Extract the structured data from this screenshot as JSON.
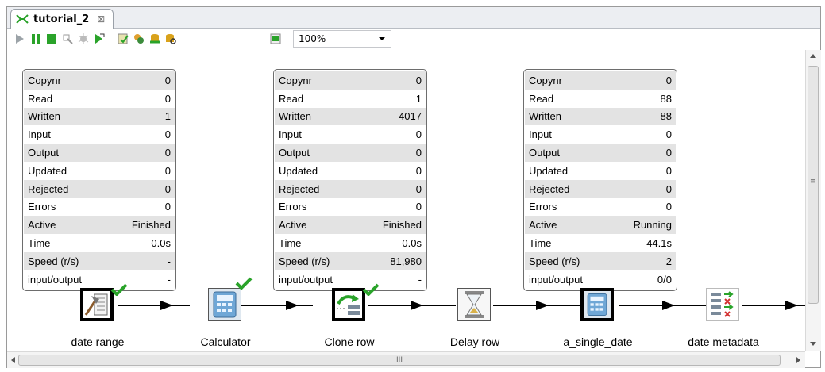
{
  "tab": {
    "title": "tutorial_2",
    "close_symbol": "⊠"
  },
  "toolbar": {
    "buttons": [
      "run-icon",
      "pause-icon",
      "stop-icon",
      "preview-icon",
      "debug-icon",
      "replay-icon",
      "verify-icon",
      "impact-icon",
      "sql-icon",
      "explore-icon",
      "show-results-icon"
    ],
    "zoom": "100%"
  },
  "stat_labels": [
    "Copynr",
    "Read",
    "Written",
    "Input",
    "Output",
    "Updated",
    "Rejected",
    "Errors",
    "Active",
    "Time",
    "Speed (r/s)",
    "input/output"
  ],
  "stats": [
    {
      "values": [
        "0",
        "0",
        "1",
        "0",
        "0",
        "0",
        "0",
        "0",
        "Finished",
        "0.0s",
        "-",
        "-"
      ]
    },
    {
      "values": [
        "0",
        "1",
        "4017",
        "0",
        "0",
        "0",
        "0",
        "0",
        "Finished",
        "0.0s",
        "81,980",
        "-"
      ]
    },
    {
      "values": [
        "0",
        "88",
        "88",
        "0",
        "0",
        "0",
        "0",
        "0",
        "Running",
        "44.1s",
        "2",
        "0/0"
      ]
    }
  ],
  "steps": [
    {
      "label": "date range",
      "icon": "date-range-icon",
      "checked": true
    },
    {
      "label": "Calculator",
      "icon": "calculator-icon",
      "checked": true
    },
    {
      "label": "Clone row",
      "icon": "clone-row-icon",
      "checked": true
    },
    {
      "label": "Delay row",
      "icon": "hourglass-icon",
      "checked": false
    },
    {
      "label": "a_single_date",
      "icon": "calculator-icon",
      "checked": false
    },
    {
      "label": "date metadata",
      "icon": "metadata-icon",
      "checked": false
    }
  ],
  "scrollbar": {
    "grip": "III",
    "vgrip": "≡"
  },
  "colors": {
    "check": "#2aa32a",
    "stats_stripe": "#e3e3e3"
  }
}
